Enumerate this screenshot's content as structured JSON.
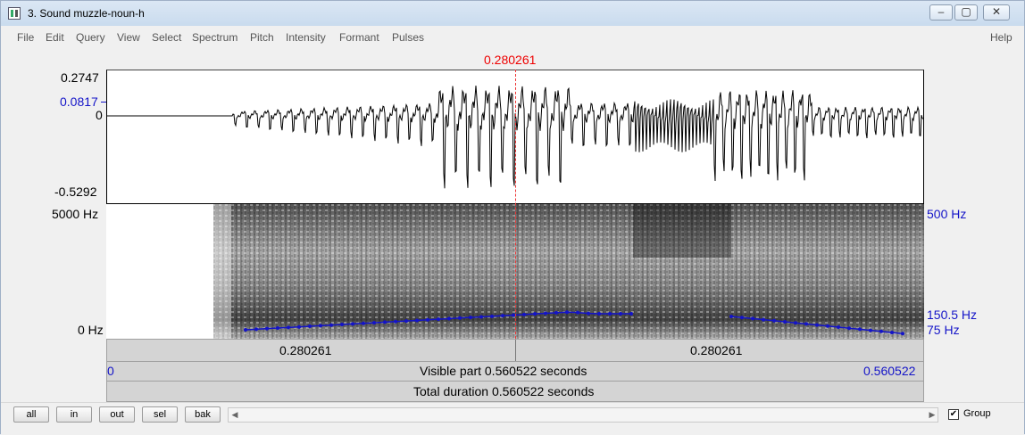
{
  "window": {
    "title": "3. Sound muzzle-noun-h"
  },
  "menu": [
    "File",
    "Edit",
    "Query",
    "View",
    "Select",
    "Spectrum",
    "Pitch",
    "Intensity",
    "Formant",
    "Pulses"
  ],
  "help": "Help",
  "cursor": {
    "time": "0.280261",
    "fraction": 0.5
  },
  "waveform": {
    "max": "0.2747",
    "mid_value": "0.0817",
    "zero": "0",
    "min": "-0.5292"
  },
  "spectrogram": {
    "top": "5000 Hz",
    "bottom": "0 Hz"
  },
  "pitch": {
    "top": "500 Hz",
    "value": "150.5 Hz",
    "bottom": "75 Hz",
    "color": "#1414c8"
  },
  "time_bar": {
    "left": "0.280261",
    "right": "0.280261"
  },
  "visible": {
    "start": "0",
    "text": "Visible part 0.560522 seconds",
    "end": "0.560522"
  },
  "total": {
    "text": "Total duration 0.560522 seconds"
  },
  "buttons": {
    "all": "all",
    "in": "in",
    "out": "out",
    "sel": "sel",
    "bak": "bak"
  },
  "group": {
    "label": "Group",
    "checked": true
  }
}
